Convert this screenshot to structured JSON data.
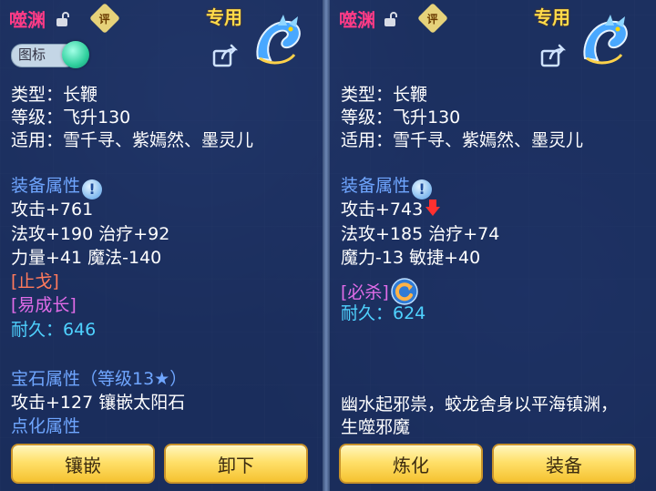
{
  "left": {
    "name": "噬渊",
    "ping_badge": "评",
    "exclusive": "专用",
    "toggle_label": "图标",
    "type_line": "类型：长鞭",
    "level_line": "等级：飞升130",
    "applicable_line": "适用：雪千寻、紫嫣然、墨灵儿",
    "equip_attr_title": "装备属性",
    "attack": "攻击+761",
    "magic_heal": "法攻+190 治疗+92",
    "str_mag": "力量+41 魔法-140",
    "special1": "[止戈]",
    "special2": "[易成长]",
    "durability": "耐久：646",
    "gem_title": "宝石属性（等级13★）",
    "gem_line": "攻击+127 镶嵌太阳石",
    "refine_title": "点化属性",
    "buttons": [
      "镶嵌",
      "卸下"
    ]
  },
  "right": {
    "name": "噬渊",
    "ping_badge": "评",
    "exclusive": "专用",
    "type_line": "类型：长鞭",
    "level_line": "等级：飞升130",
    "applicable_line": "适用：雪千寻、紫嫣然、墨灵儿",
    "equip_attr_title": "装备属性",
    "attack": "攻击+743",
    "magic_heal": "法攻+185 治疗+74",
    "mag_agi": "魔力-13 敏捷+40",
    "special1": "[必杀]",
    "durability": "耐久：624",
    "description_1": "幽水起邪祟，蛟龙舍身以平海镇渊，",
    "description_2": "生噬邪魔",
    "buttons": [
      "炼化",
      "装备"
    ]
  },
  "colors": {
    "name": "#ff3b86",
    "exclusive": "#ffdb4a",
    "section": "#6fa6ff",
    "durability": "#4fd2ff",
    "button_fill": "#ffe06a"
  }
}
